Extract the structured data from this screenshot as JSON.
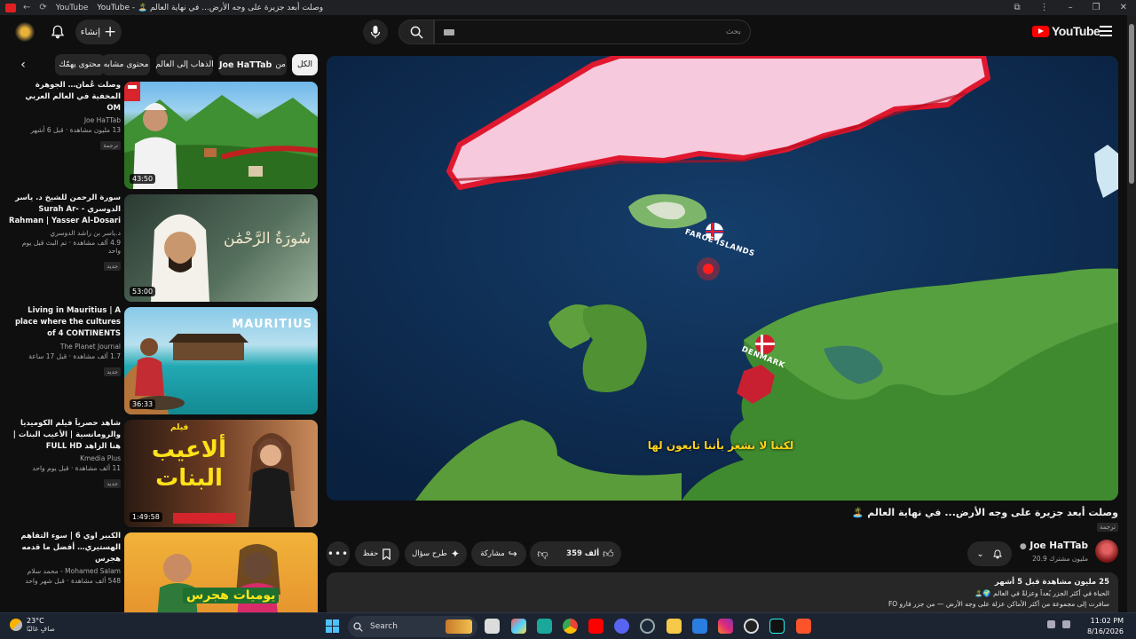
{
  "browser": {
    "title": "وصلت أبعد جزيرة على وجه الأرض... في نهاية العالم 🏝️ - YouTube",
    "address": "YouTube"
  },
  "header": {
    "create_label": "إنشاء",
    "search_placeholder": "بحث",
    "logo_text": "YouTube"
  },
  "chips": {
    "all": "الكل",
    "from_prefix": "من",
    "from_channel": "Joe HaTTab",
    "travel": "الذهاب إلى العالم",
    "similar": "محتوى مشابه",
    "interest": "محتوى يهمّك"
  },
  "recommendations": [
    {
      "title": "وصلت عُمان… الجوهرة المخفية في العالم العربي OM",
      "channel": "Joe HaTTab",
      "meta": "13 مليون مشاهدة · قبل 6 أشهر",
      "badge": "ترجمة",
      "duration": "43:50"
    },
    {
      "title": "سورة الرحمن للشيخ د. ياسر الدوسري - Surah Ar-Rahman | Yasser Al-Dosari",
      "channel": "د.ياسر بن راشد الدوسري",
      "meta": "4.9 ألف مشاهدة · تم البث قبل يوم واحد",
      "badge": "جديد",
      "duration": "53:00",
      "overlay": "سُورَةُ الرَّحْمَٰن"
    },
    {
      "title": "Living in Mauritius | A place where the cultures of 4 CONTINENTS intersect | 4K",
      "channel": "The Planet Journal",
      "meta": "1.7 ألف مشاهدة · قبل 17 ساعة",
      "badge": "جديد",
      "duration": "36:33",
      "overlay": "MAURITIUS"
    },
    {
      "title": "شاهد حصرياً فيلم الكوميديا والرومانسية | الأعيب البنات | هنا الزاهد FULL HD",
      "channel": "Kmedia Plus",
      "meta": "11 ألف مشاهدة · قبل يوم واحد",
      "badge": "جديد",
      "duration": "1:49:58",
      "overlay": "ألاعيب البنات",
      "overlay_small": "فيلم"
    },
    {
      "title": "الكبير اوي 6 | سوء التفاهم الهستيري… أفضل ما قدمه هجرس",
      "channel": "Mohamed Salam - محمد سلام",
      "meta": "548 ألف مشاهدة · قبل شهر واحد",
      "badge": "",
      "duration": "",
      "overlay": "يوميات هجرس"
    }
  ],
  "player": {
    "label_faroe": "FAROE ISLANDS",
    "label_denmark": "DENMARK",
    "subtitle": "لكننا لا نشعر بأننا تابعون لها"
  },
  "video": {
    "title": "وصلت أبعد جزيرة على وجه الأرض... في نهاية العالم 🏝️",
    "title_badge": "ترجمة",
    "channel_name": "Joe HaTTab",
    "subscribers": "20.9 مليون مشترك",
    "likes": "359 ألف",
    "share_label": "مشاركة",
    "ask_label": "طرح سؤال",
    "save_label": "حفظ"
  },
  "description": {
    "stats": "25 مليون مشاهدة قبل 5 أشهر",
    "line1": "الحياة في أكثر الجزر بُعداً وعزلةً في العالم 🌍🏝️",
    "line2": "سافرت إلى مجموعة من أكثر الأماكن عزلة على وجه الأرض — من جزر فارو FO"
  },
  "taskbar": {
    "temperature": "23°C",
    "weather_desc": "صافٍ غالبًا",
    "search_label": "Search",
    "time": "11:02 PM",
    "date": "8/16/2026"
  },
  "colors": {
    "background": "#0f0f0f",
    "chip": "#272727",
    "brand_red": "#ff0000",
    "greenland": "#f6c9dc",
    "ocean": "#0b2747",
    "subtitle": "#ffd21a"
  }
}
